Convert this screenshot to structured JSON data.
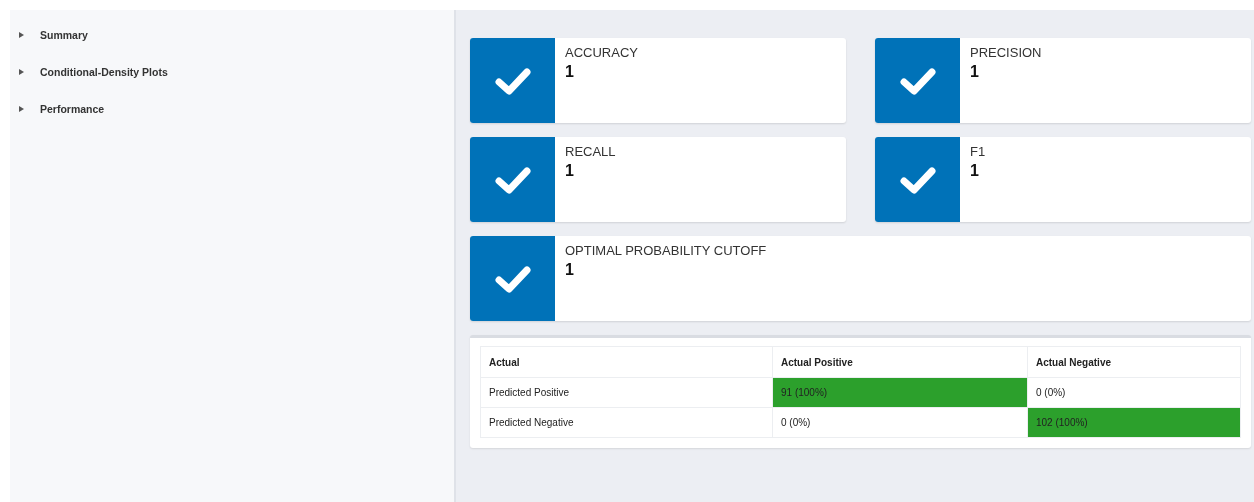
{
  "sidebar": {
    "items": [
      {
        "label": "Summary",
        "expanded": false
      },
      {
        "label": "Conditional-Density Plots",
        "expanded": false
      },
      {
        "label": "Performance",
        "expanded": false
      }
    ]
  },
  "metrics": [
    {
      "title": "ACCURACY",
      "value": "1",
      "wide": false
    },
    {
      "title": "PRECISION",
      "value": "1",
      "wide": false
    },
    {
      "title": "RECALL",
      "value": "1",
      "wide": false
    },
    {
      "title": "F1",
      "value": "1",
      "wide": false
    },
    {
      "title": "OPTIMAL PROBABILITY CUTOFF",
      "value": "1",
      "wide": true
    }
  ],
  "confusion_table": {
    "columns": [
      "Actual",
      "Actual Positive",
      "Actual Negative"
    ],
    "rows": [
      {
        "cells": [
          {
            "text": "Predicted Positive",
            "highlight": false
          },
          {
            "text": "91 (100%)",
            "highlight": true
          },
          {
            "text": "0 (0%)",
            "highlight": false
          }
        ]
      },
      {
        "cells": [
          {
            "text": "Predicted Negative",
            "highlight": false
          },
          {
            "text": "0 (0%)",
            "highlight": false
          },
          {
            "text": "102 (100%)",
            "highlight": true
          }
        ]
      }
    ]
  }
}
